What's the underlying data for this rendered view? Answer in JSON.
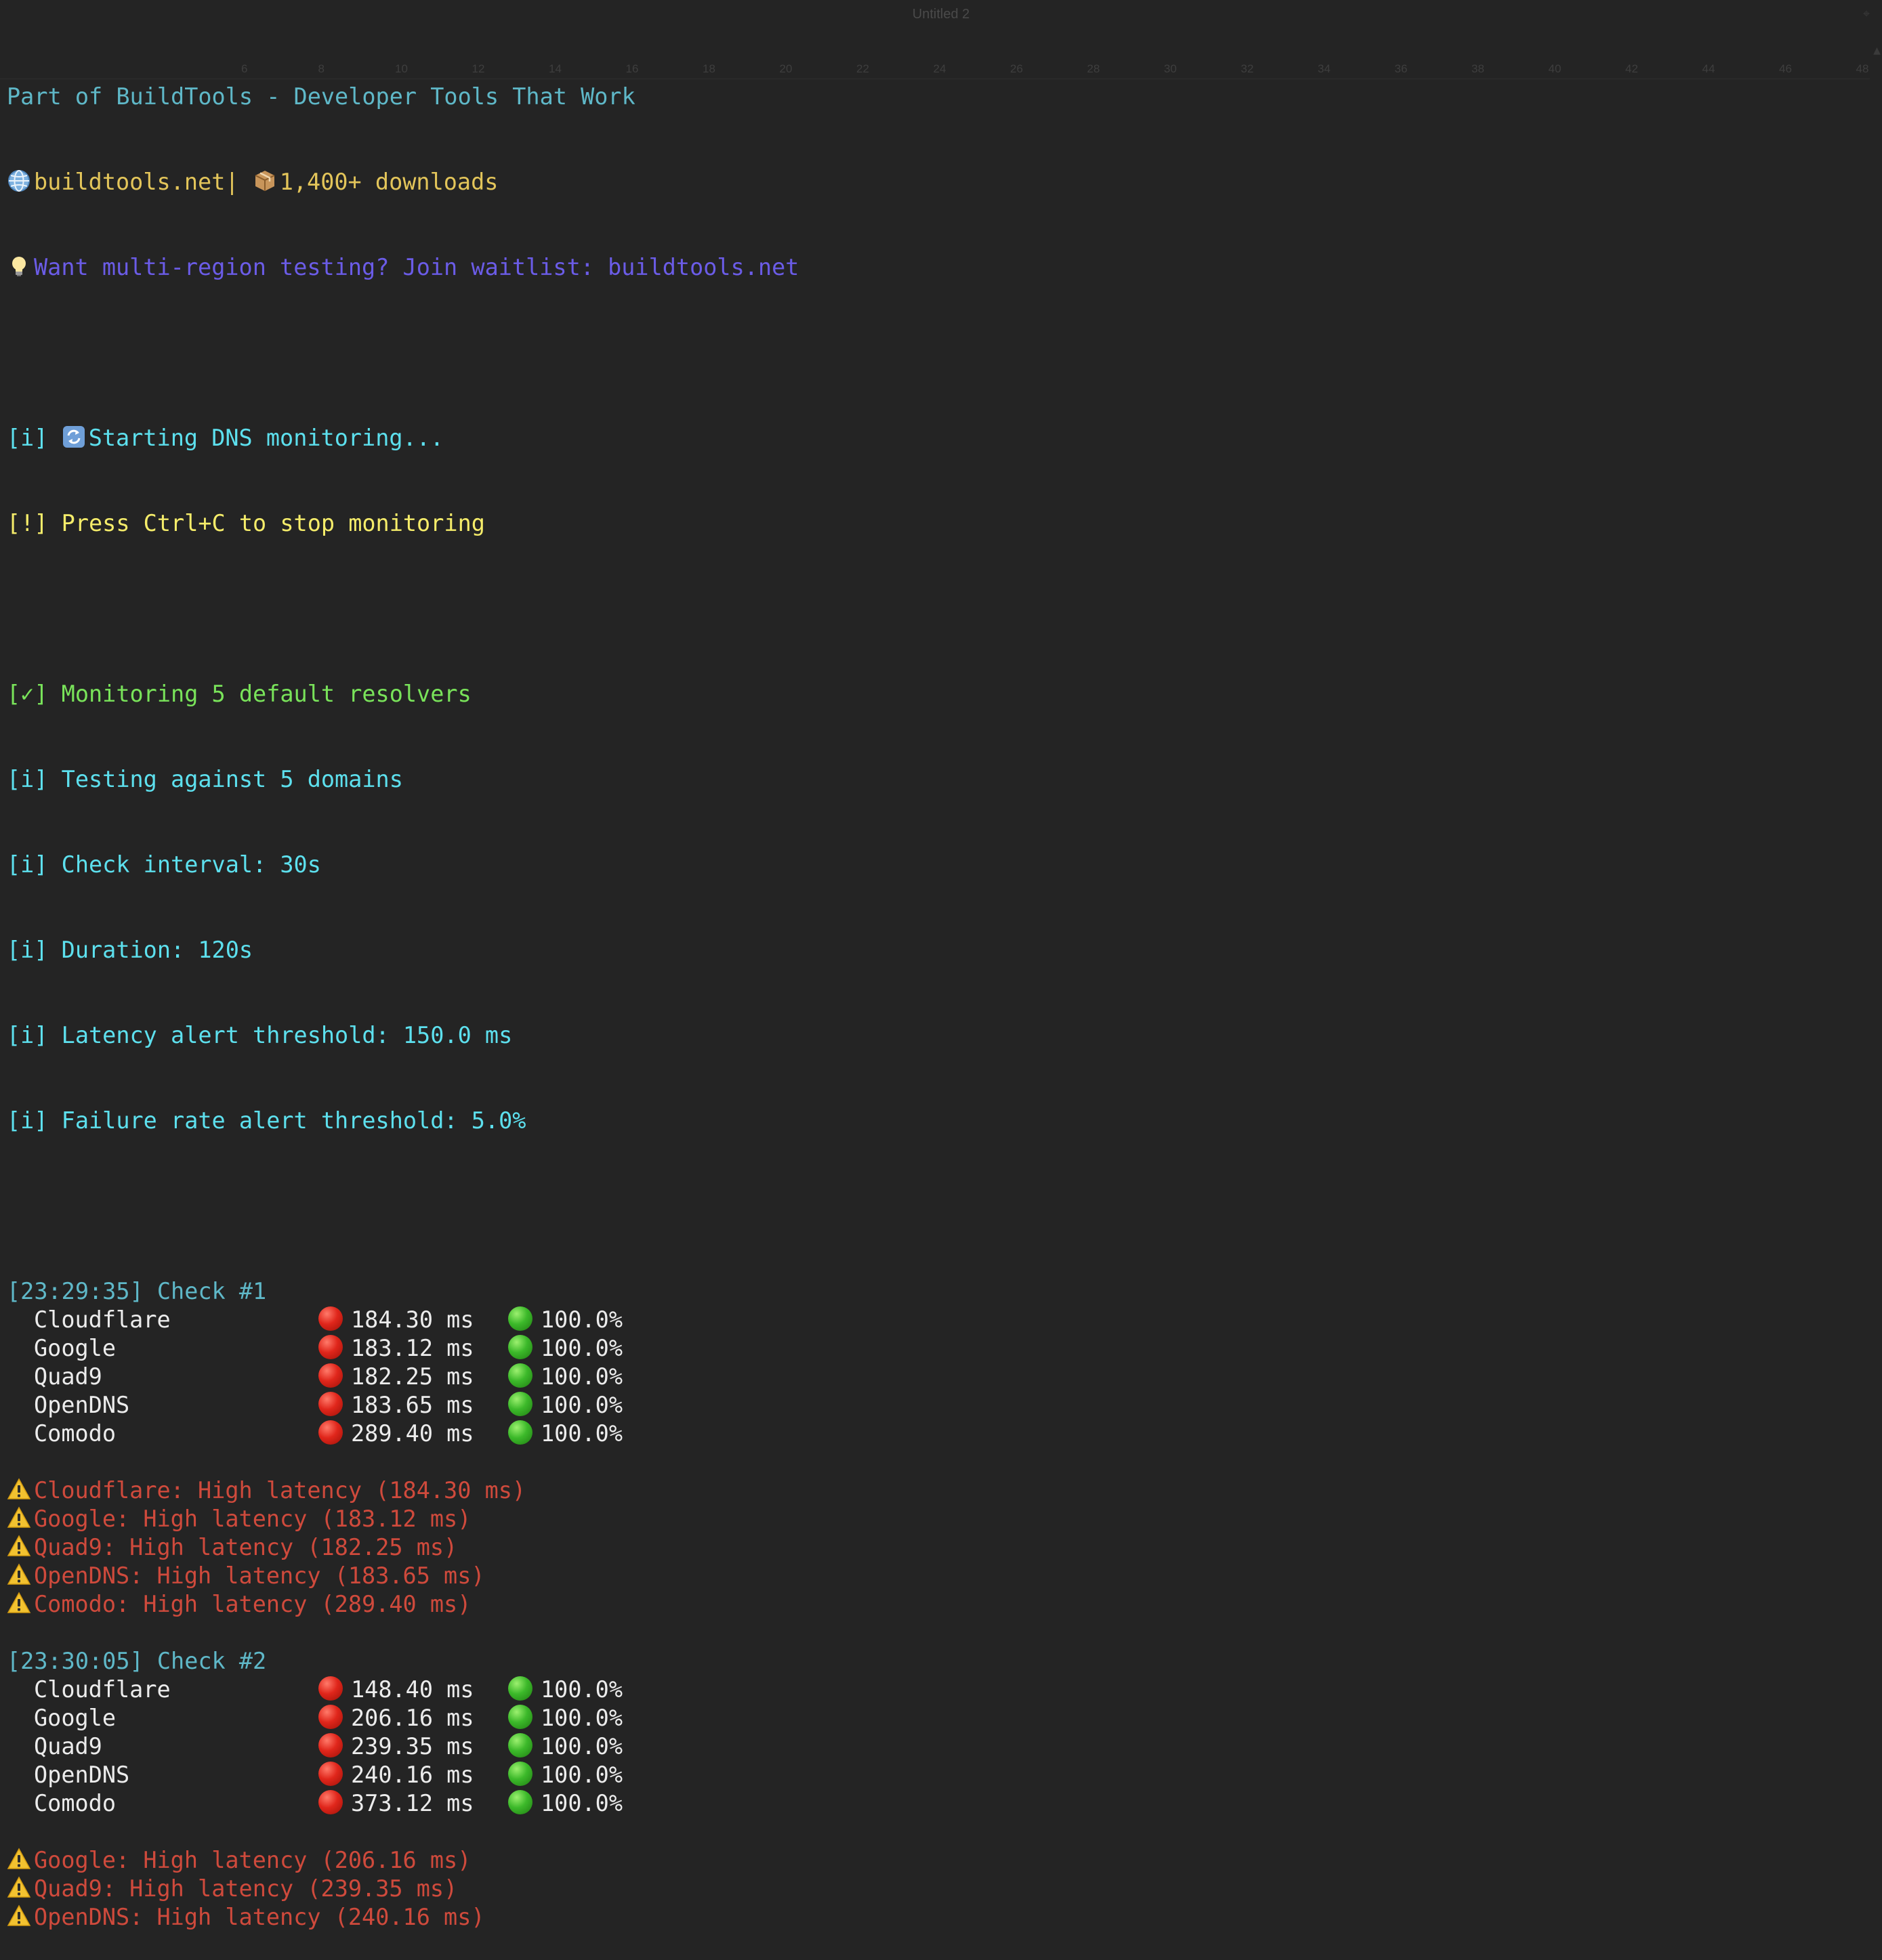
{
  "window": {
    "title": "Untitled 2",
    "ruler_ticks": [
      "6",
      "8",
      "10",
      "12",
      "14",
      "16",
      "18",
      "20",
      "22",
      "24",
      "26",
      "28",
      "30",
      "32",
      "34",
      "36",
      "38",
      "40",
      "42",
      "44",
      "46",
      "48"
    ]
  },
  "header": {
    "line1": "Part of BuildTools - Developer Tools That Work",
    "site": "buildtools.net",
    "separator": "| ",
    "downloads": "1,400+ downloads",
    "waitlist": "Want multi-region testing? Join waitlist: buildtools.net"
  },
  "startup": {
    "starting_prefix": "[i] ",
    "starting_text": "Starting DNS monitoring...",
    "stop_hint": "[!] Press Ctrl+C to stop monitoring",
    "monitoring_resolvers": "[✓] Monitoring 5 default resolvers",
    "testing_domains": "[i] Testing against 5 domains",
    "check_interval": "[i] Check interval: 30s",
    "duration": "[i] Duration: 120s",
    "latency_threshold": "[i] Latency alert threshold: 150.0 ms",
    "failure_threshold": "[i] Failure rate alert threshold: 5.0%"
  },
  "checks": [
    {
      "header": "[23:29:35] Check #1",
      "rows": [
        {
          "name": "Cloudflare",
          "latency": "184.30 ms",
          "success": "100.0%"
        },
        {
          "name": "Google",
          "latency": "183.12 ms",
          "success": "100.0%"
        },
        {
          "name": "Quad9",
          "latency": "182.25 ms",
          "success": "100.0%"
        },
        {
          "name": "OpenDNS",
          "latency": "183.65 ms",
          "success": "100.0%"
        },
        {
          "name": "Comodo",
          "latency": "289.40 ms",
          "success": "100.0%"
        }
      ],
      "alerts": [
        "Cloudflare: High latency (184.30 ms)",
        "Google: High latency (183.12 ms)",
        "Quad9: High latency (182.25 ms)",
        "OpenDNS: High latency (183.65 ms)",
        "Comodo: High latency (289.40 ms)"
      ]
    },
    {
      "header": "[23:30:05] Check #2",
      "rows": [
        {
          "name": "Cloudflare",
          "latency": "148.40 ms",
          "success": "100.0%"
        },
        {
          "name": "Google",
          "latency": "206.16 ms",
          "success": "100.0%"
        },
        {
          "name": "Quad9",
          "latency": "239.35 ms",
          "success": "100.0%"
        },
        {
          "name": "OpenDNS",
          "latency": "240.16 ms",
          "success": "100.0%"
        },
        {
          "name": "Comodo",
          "latency": "373.12 ms",
          "success": "100.0%"
        }
      ],
      "alerts": [
        "Google: High latency (206.16 ms)",
        "Quad9: High latency (239.35 ms)",
        "OpenDNS: High latency (240.16 ms)"
      ]
    }
  ],
  "icons": {
    "globe": "globe-icon",
    "package": "package-icon",
    "bulb": "lightbulb-icon",
    "refresh": "refresh-icon",
    "status_latency": "red-circle-icon",
    "status_success": "green-circle-icon",
    "warning": "warning-icon"
  },
  "colors": {
    "background": "#242424",
    "info": "#5de0ee",
    "header_teal": "#5fb8c8",
    "promo_gold": "#e3c55a",
    "waitlist_purple": "#6b5ce7",
    "warning_yellow": "#f5ec6a",
    "success_green": "#79e35a",
    "alert_red": "#cf4a3c"
  }
}
